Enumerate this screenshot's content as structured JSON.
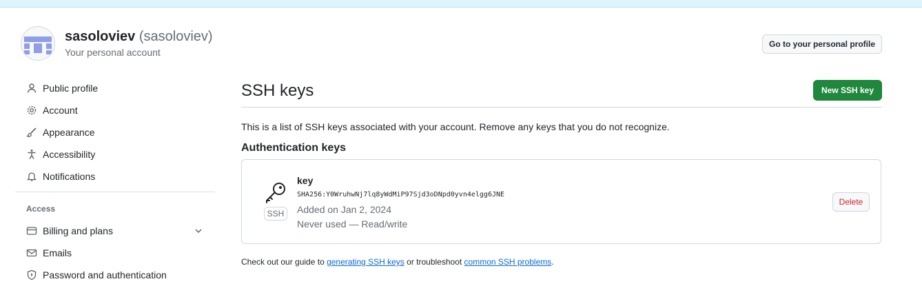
{
  "account": {
    "login": "sasoloviev",
    "handle": "(sasoloviev)",
    "subtitle": "Your personal account",
    "profile_button": "Go to your personal profile"
  },
  "sidebar": {
    "items": [
      {
        "label": "Public profile",
        "icon": "person-icon"
      },
      {
        "label": "Account",
        "icon": "gear-icon"
      },
      {
        "label": "Appearance",
        "icon": "paintbrush-icon"
      },
      {
        "label": "Accessibility",
        "icon": "accessibility-icon"
      },
      {
        "label": "Notifications",
        "icon": "bell-icon"
      }
    ],
    "access_heading": "Access",
    "access_items": [
      {
        "label": "Billing and plans",
        "icon": "credit-card-icon"
      },
      {
        "label": "Emails",
        "icon": "mail-icon"
      },
      {
        "label": "Password and authentication",
        "icon": "shield-lock-icon"
      }
    ]
  },
  "main": {
    "title": "SSH keys",
    "new_key_button": "New SSH key",
    "intro": "This is a list of SSH keys associated with your account. Remove any keys that you do not recognize.",
    "section_title": "Authentication keys",
    "key": {
      "title": "key",
      "fingerprint": "SHA256:Y0WruhwNj7lq8yWdMiP97Sjd3oDNpd0yvn4elgg6JNE",
      "added": "Added on Jan 2, 2024",
      "usage": "Never used — Read/write",
      "type_label": "SSH",
      "delete_button": "Delete"
    },
    "guide": {
      "prefix": "Check out our guide to ",
      "link1": "generating SSH keys",
      "middle": " or troubleshoot ",
      "link2": "common SSH problems",
      "suffix": "."
    }
  },
  "colors": {
    "primary_button": "#1f883d",
    "danger_text": "#cf222e",
    "link": "#0969da",
    "banner": "#ddf4ff"
  }
}
